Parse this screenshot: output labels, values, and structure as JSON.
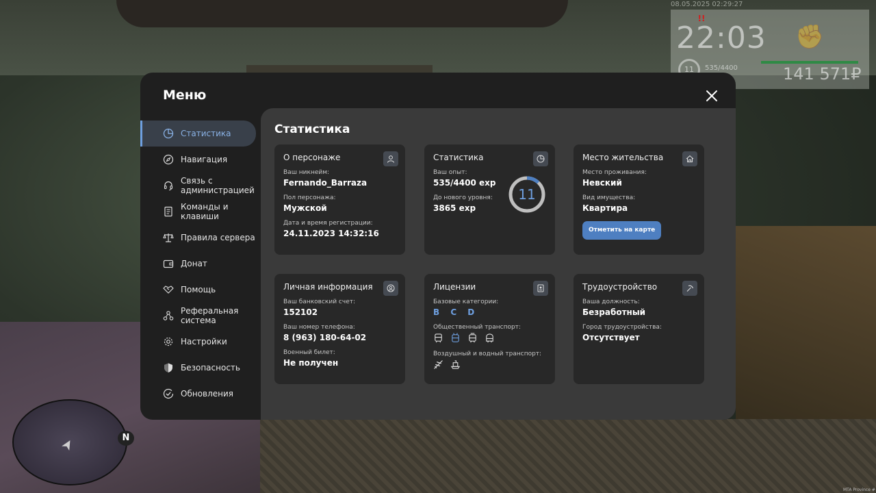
{
  "hud": {
    "datetime": "08.05.2025 02:29:27",
    "alert": "!!",
    "time": "22:03",
    "level": "11",
    "exp": "535/4400",
    "money": "141 571₽",
    "radar_north": "N",
    "watermark": "MTA Province #"
  },
  "menu": {
    "title": "Меню",
    "nav": [
      {
        "label": "Статистика",
        "icon": "pie-chart-icon",
        "active": true
      },
      {
        "label": "Навигация",
        "icon": "compass-icon"
      },
      {
        "label": "Связь с администрацией",
        "icon": "headset-icon"
      },
      {
        "label": "Команды и клавиши",
        "icon": "document-icon"
      },
      {
        "label": "Правила сервера",
        "icon": "scales-icon"
      },
      {
        "label": "Донат",
        "icon": "wallet-icon"
      },
      {
        "label": "Помощь",
        "icon": "handshake-icon"
      },
      {
        "label": "Реферальная система",
        "icon": "network-icon"
      },
      {
        "label": "Настройки",
        "icon": "gear-icon"
      },
      {
        "label": "Безопасность",
        "icon": "shield-icon"
      },
      {
        "label": "Обновления",
        "icon": "check-circle-icon"
      }
    ]
  },
  "content": {
    "title": "Статистика",
    "character": {
      "title": "О персонаже",
      "nickname_label": "Ваш никнейм:",
      "nickname": "Fernando_Barraza",
      "gender_label": "Пол персонажа:",
      "gender": "Мужской",
      "reg_label": "Дата и время регистрации:",
      "reg": "24.11.2023 14:32:16"
    },
    "stats": {
      "title": "Статистика",
      "exp_label": "Ваш опыт:",
      "exp": "535/4400 exp",
      "next_label": "До нового уровня:",
      "next": "3865 exp",
      "level": "11",
      "level_progress": 0.12
    },
    "residence": {
      "title": "Место жительства",
      "place_label": "Место проживания:",
      "place": "Невский",
      "property_label": "Вид имущества:",
      "property": "Квартира",
      "map_button": "Отметить на карте"
    },
    "personal": {
      "title": "Личная информация",
      "bank_label": "Ваш банковский счет:",
      "bank": "152102",
      "phone_label": "Ваш номер телефона:",
      "phone": "8 (963) 180-64-02",
      "military_label": "Военный билет:",
      "military": "Не получен"
    },
    "licenses": {
      "title": "Лицензии",
      "base_label": "Базовые категории:",
      "base": "B C D",
      "public_label": "Общественный транспорт:",
      "air_label": "Воздушный и водный транспорт:"
    },
    "job": {
      "title": "Трудоустройство",
      "position_label": "Ваша должность:",
      "position": "Безработный",
      "city_label": "Город трудоустройства:",
      "city": "Отсутствует"
    }
  },
  "colors": {
    "accent": "#6e9fe0",
    "button": "#4e7fc1",
    "panel": "#1f1f1f",
    "content": "#3a3a3a",
    "card": "#282828"
  }
}
